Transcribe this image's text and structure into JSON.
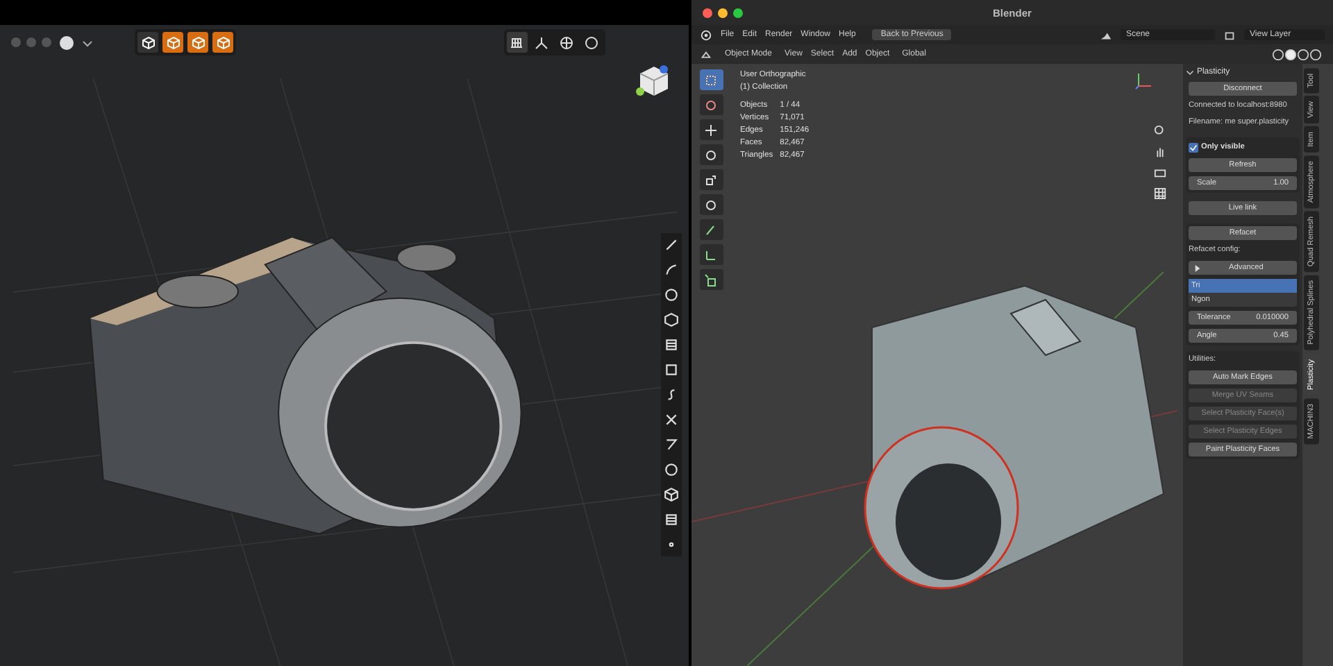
{
  "left_app": {
    "toolbar": [
      {
        "selected": false
      },
      {
        "selected": true
      },
      {
        "selected": true
      },
      {
        "selected": true
      }
    ],
    "view_buttons": [
      {
        "selected": true
      },
      {
        "selected": false
      },
      {
        "selected": false
      },
      {
        "selected": false
      }
    ]
  },
  "blender": {
    "title": "Blender",
    "menu": [
      "File",
      "Edit",
      "Render",
      "Window",
      "Help"
    ],
    "back_button": "Back to Previous",
    "scene": "Scene",
    "view_layer": "View Layer",
    "header": {
      "mode": "Object Mode",
      "menus": [
        "View",
        "Select",
        "Add",
        "Object"
      ],
      "orientation": "Global"
    },
    "overlay": {
      "view": "User Orthographic",
      "collection": "(1) Collection",
      "stats": [
        {
          "label": "Objects",
          "value": "1 / 44"
        },
        {
          "label": "Vertices",
          "value": "71,071"
        },
        {
          "label": "Edges",
          "value": "151,246"
        },
        {
          "label": "Faces",
          "value": "82,467"
        },
        {
          "label": "Triangles",
          "value": "82,467"
        }
      ]
    },
    "tools": [
      {
        "selected": true
      },
      {
        "selected": false
      },
      {
        "selected": false
      },
      {
        "selected": false
      },
      {
        "selected": false
      },
      {
        "selected": false
      },
      {
        "selected": false
      },
      {
        "selected": false
      },
      {
        "selected": false
      }
    ],
    "panel": {
      "title": "Plasticity",
      "expanded": true,
      "sections": [
        {
          "items": [
            {
              "kind": "button",
              "label": "Disconnect",
              "disabled": false
            },
            {
              "kind": "text",
              "label": "Connected to localhost:8980"
            },
            {
              "kind": "text",
              "label": "Filename: me super.plasticity"
            }
          ]
        },
        {
          "boxed": true,
          "items": [
            {
              "kind": "checkbox",
              "label": "Only visible",
              "checked": true
            },
            {
              "kind": "button",
              "label": "Refresh",
              "disabled": false
            },
            {
              "kind": "field",
              "label": "Scale",
              "value": "1.00"
            }
          ]
        },
        {
          "items": [
            {
              "kind": "button",
              "label": "Live link",
              "disabled": false
            }
          ]
        },
        {
          "boxed": true,
          "items": [
            {
              "kind": "button",
              "label": "Refacet",
              "disabled": false
            },
            {
              "kind": "text",
              "label": "Refacet config:"
            },
            {
              "kind": "disclosure",
              "label": "Advanced",
              "expanded": false
            },
            {
              "kind": "list",
              "options": [
                {
                  "label": "Tri",
                  "selected": true
                },
                {
                  "label": "Ngon",
                  "selected": false
                }
              ]
            },
            {
              "kind": "field",
              "label": "Tolerance",
              "value": "0.010000"
            },
            {
              "kind": "field",
              "label": "Angle",
              "value": "0.45"
            }
          ]
        },
        {
          "boxed": true,
          "items": [
            {
              "kind": "text",
              "label": "Utilities:"
            },
            {
              "kind": "button",
              "label": "Auto Mark Edges",
              "disabled": false
            },
            {
              "kind": "button",
              "label": "Merge UV Seams",
              "disabled": true
            },
            {
              "kind": "button",
              "label": "Select Plasticity Face(s)",
              "disabled": true
            },
            {
              "kind": "button",
              "label": "Select Plasticity Edges",
              "disabled": true
            },
            {
              "kind": "button",
              "label": "Paint Plasticity Faces",
              "disabled": false
            }
          ]
        }
      ]
    },
    "tabs": [
      {
        "label": "Tool",
        "selected": false
      },
      {
        "label": "View",
        "selected": false
      },
      {
        "label": "Item",
        "selected": false
      },
      {
        "label": "Atmosphere",
        "selected": false
      },
      {
        "label": "Quad Remesh",
        "selected": false
      },
      {
        "label": "Polyhedral Splines",
        "selected": false
      },
      {
        "label": "Plasticity",
        "selected": true
      },
      {
        "label": "MACHIN3",
        "selected": false
      }
    ]
  }
}
